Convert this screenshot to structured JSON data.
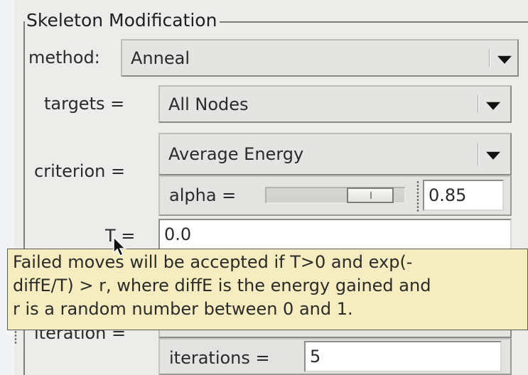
{
  "group": {
    "title": "Skeleton Modification"
  },
  "method": {
    "label": "method:",
    "value": "Anneal"
  },
  "targets": {
    "label": "targets =",
    "value": "All Nodes"
  },
  "criterion": {
    "label": "criterion =",
    "value": "Average Energy",
    "alpha": {
      "label": "alpha =",
      "value": "0.85",
      "slider_fraction": 0.85
    }
  },
  "temperature": {
    "label": "T =",
    "value": "0.0"
  },
  "tooltip": {
    "lines": [
      "Failed moves will be accepted if T>0 and exp(-",
      "diffE/T) > r, where diffE is the energy gained and",
      "r is a random number between 0 and 1."
    ]
  },
  "iteration": {
    "label": "iteration =",
    "iterations": {
      "label": "iterations =",
      "value": "5"
    }
  },
  "icons": {
    "dropdown": "chevron-down-icon",
    "cursor": "mouse-pointer-icon"
  },
  "colors": {
    "tooltip_bg": "#f5edbf",
    "panel_bg": "#ececeb",
    "page_bg": "#f2f3f4"
  }
}
